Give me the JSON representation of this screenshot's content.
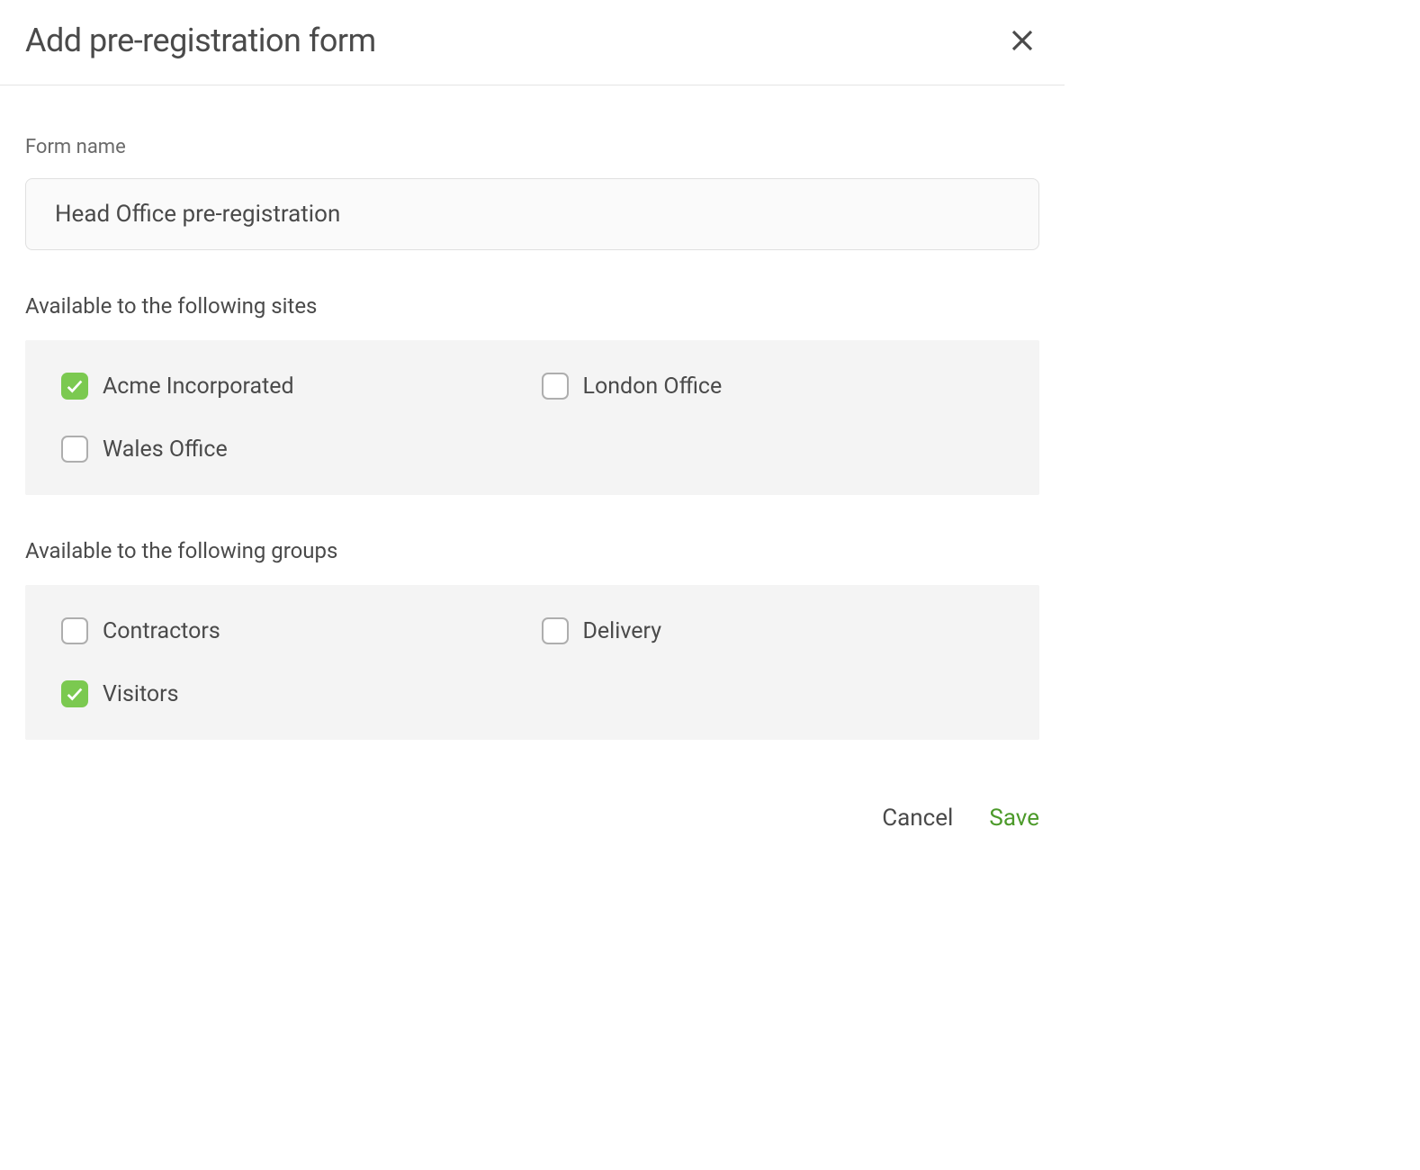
{
  "header": {
    "title": "Add pre-registration form"
  },
  "form": {
    "name_label": "Form name",
    "name_value": "Head Office pre-registration"
  },
  "sites": {
    "label": "Available to the following sites",
    "items": [
      {
        "label": "Acme Incorporated",
        "checked": true
      },
      {
        "label": "London Office",
        "checked": false
      },
      {
        "label": "Wales Office",
        "checked": false
      }
    ]
  },
  "groups": {
    "label": "Available to the following groups",
    "items": [
      {
        "label": "Contractors",
        "checked": false
      },
      {
        "label": "Delivery",
        "checked": false
      },
      {
        "label": "Visitors",
        "checked": true
      }
    ]
  },
  "footer": {
    "cancel_label": "Cancel",
    "save_label": "Save"
  }
}
